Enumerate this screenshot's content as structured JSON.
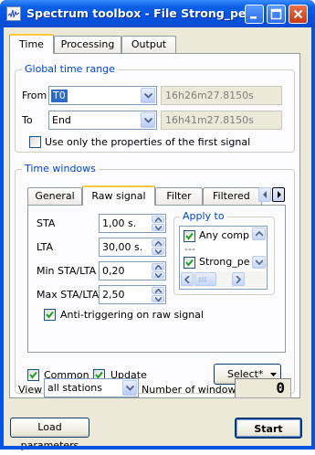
{
  "window": {
    "title": "Spectrum toolbox - File Strong_peak"
  },
  "main_tabs": [
    {
      "label": "Time"
    },
    {
      "label": "Processing"
    },
    {
      "label": "Output"
    }
  ],
  "global_time_range": {
    "label": "Global time range",
    "from": {
      "label": "From",
      "value": "T0",
      "time": "16h26m27.8150s"
    },
    "to": {
      "label": "To",
      "value": "End",
      "time": "16h41m27.8150s"
    },
    "first_signal_label": "Use only the properties of the first signal",
    "first_signal_checked": false
  },
  "time_windows": {
    "label": "Time windows",
    "tabs": [
      {
        "label": "General"
      },
      {
        "label": "Raw signal"
      },
      {
        "label": "Filter"
      },
      {
        "label": "Filtered si"
      }
    ],
    "sta": {
      "label": "STA",
      "value": "1,00 s."
    },
    "lta": {
      "label": "LTA",
      "value": "30,00 s."
    },
    "min_ratio": {
      "label": "Min STA/LTA",
      "value": "0,20"
    },
    "max_ratio": {
      "label": "Max STA/LTA",
      "value": "2,50"
    },
    "apply_to": {
      "label": "Apply to",
      "items": [
        {
          "label": "Any comp",
          "checked": true
        },
        {
          "label": "---",
          "checked": null
        },
        {
          "label": "Strong_pe",
          "checked": true
        }
      ]
    },
    "anti_trigger": {
      "label": "Anti-triggering on raw signal",
      "checked": true
    },
    "common": {
      "label": "Common",
      "checked": true
    },
    "update": {
      "label": "Update",
      "checked": true
    },
    "select_label": "Select*"
  },
  "view": {
    "label": "View",
    "value": "all stations"
  },
  "windows_count": {
    "label": "Number of windows",
    "value": "0"
  },
  "buttons": {
    "load": "Load parameters",
    "start": "Start"
  }
}
